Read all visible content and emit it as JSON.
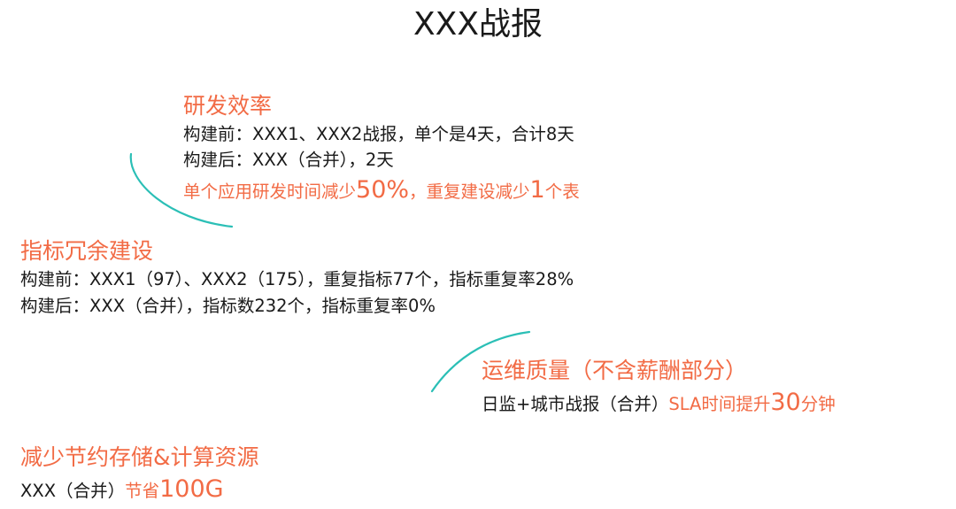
{
  "title": "XXX战报",
  "rd_efficiency": {
    "heading": "研发效率",
    "before": "构建前：XXX1、XXX2战报，单个是4天，合计8天",
    "after": "构建后：XXX（合并），2天",
    "result_a": "单个应用研发时间减少",
    "result_b": "50%",
    "result_c": "，重复建设减少",
    "result_d": "1",
    "result_e": "个表"
  },
  "metric_redundancy": {
    "heading": "指标冗余建设",
    "before": "构建前：XXX1（97）、XXX2（175），重复指标77个，指标重复率28%",
    "after": "构建后：XXX（合并），指标数232个，指标重复率0%"
  },
  "ops_quality": {
    "heading": "运维质量（不含薪酬部分）",
    "line_a": "日监+城市战报（合并）",
    "line_b": "SLA时间提升",
    "line_c": "30",
    "line_d": "分钟"
  },
  "resources": {
    "heading": "减少节约存储&计算资源",
    "line_a": "XXX（合并）",
    "line_b": "节省",
    "line_c": "100G"
  },
  "colors": {
    "accent": "#f26b45",
    "curve": "#2bbfb6",
    "text": "#1a1a1a"
  }
}
